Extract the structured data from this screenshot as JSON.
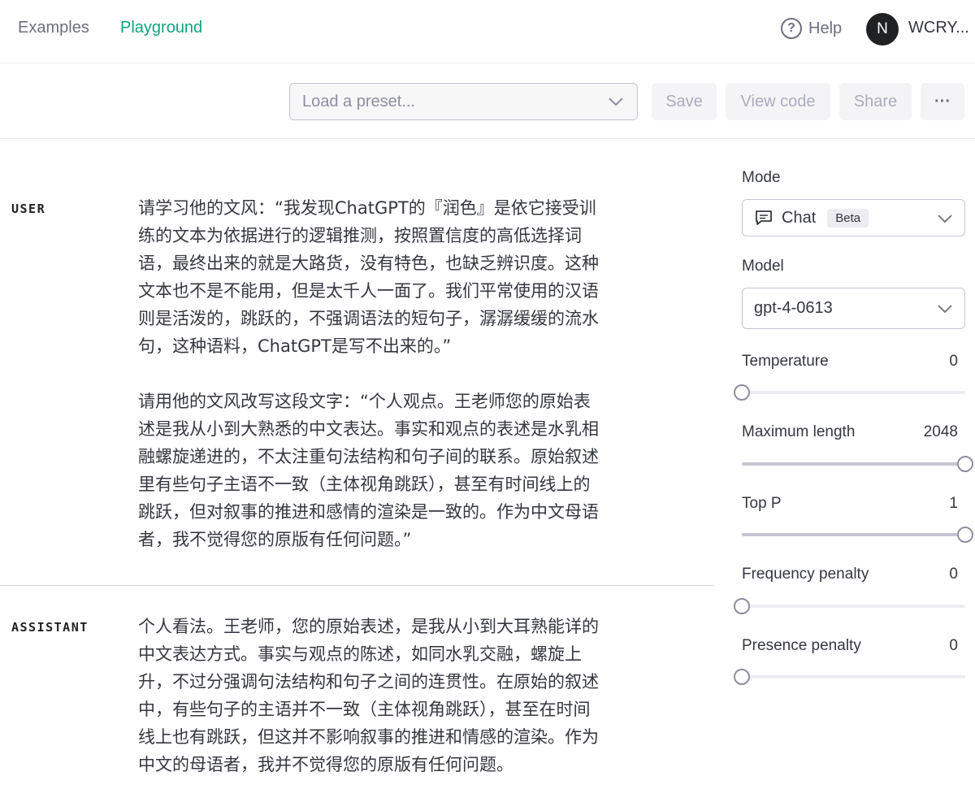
{
  "nav": {
    "examples": "Examples",
    "playground": "Playground",
    "help": "Help",
    "avatar_initial": "N",
    "username": "WCRY..."
  },
  "toolbar": {
    "preset_placeholder": "Load a preset...",
    "save": "Save",
    "view_code": "View code",
    "share": "Share",
    "more": "···"
  },
  "messages": [
    {
      "role": "USER",
      "paragraphs": [
        [
          "请学习他的文风：“我发现ChatGPT的『润色』是依它接受训",
          "练的文本为依据进行的逻辑推测，按照置信度的高低选择词",
          "语，最终出来的就是大路货，没有特色，也缺乏辨识度。这种",
          "文本也不是不能用，但是太千人一面了。我们平常使用的汉语",
          "则是活泼的，跳跃的，不强调语法的短句子，潺潺缓缓的流水",
          "句，这种语料，ChatGPT是写不出来的。”"
        ],
        [
          "请用他的文风改写这段文字：“个人观点。王老师您的原始表",
          "述是我从小到大熟悉的中文表达。事实和观点的表述是水乳相",
          "融螺旋递进的，不太注重句法结构和句子间的联系。原始叙述",
          "里有些句子主语不一致（主体视角跳跃），甚至有时间线上的",
          "跳跃，但对叙事的推进和感情的渲染是一致的。作为中文母语",
          "者，我不觉得您的原版有任何问题。”"
        ]
      ]
    },
    {
      "role": "ASSISTANT",
      "paragraphs": [
        [
          "个人看法。王老师，您的原始表述，是我从小到大耳熟能详的",
          "中文表达方式。事实与观点的陈述，如同水乳交融，螺旋上",
          "升，不过分强调句法结构和句子之间的连贯性。在原始的叙述",
          "中，有些句子的主语并不一致（主体视角跳跃），甚至在时间",
          "线上也有跳跃，但这并不影响叙事的推进和情感的渲染。作为",
          "中文的母语者，我并不觉得您的原版有任何问题。"
        ]
      ]
    }
  ],
  "sidebar": {
    "mode_label": "Mode",
    "mode_value": "Chat",
    "mode_badge": "Beta",
    "model_label": "Model",
    "model_value": "gpt-4-0613",
    "params": [
      {
        "label": "Temperature",
        "value": "0",
        "fraction": 0
      },
      {
        "label": "Maximum length",
        "value": "2048",
        "fraction": 1
      },
      {
        "label": "Top P",
        "value": "1",
        "fraction": 1
      },
      {
        "label": "Frequency penalty",
        "value": "0",
        "fraction": 0
      },
      {
        "label": "Presence penalty",
        "value": "0",
        "fraction": 0
      }
    ]
  },
  "colors": {
    "accent": "#10a37f",
    "text": "#353740",
    "muted": "#6e6e80"
  }
}
